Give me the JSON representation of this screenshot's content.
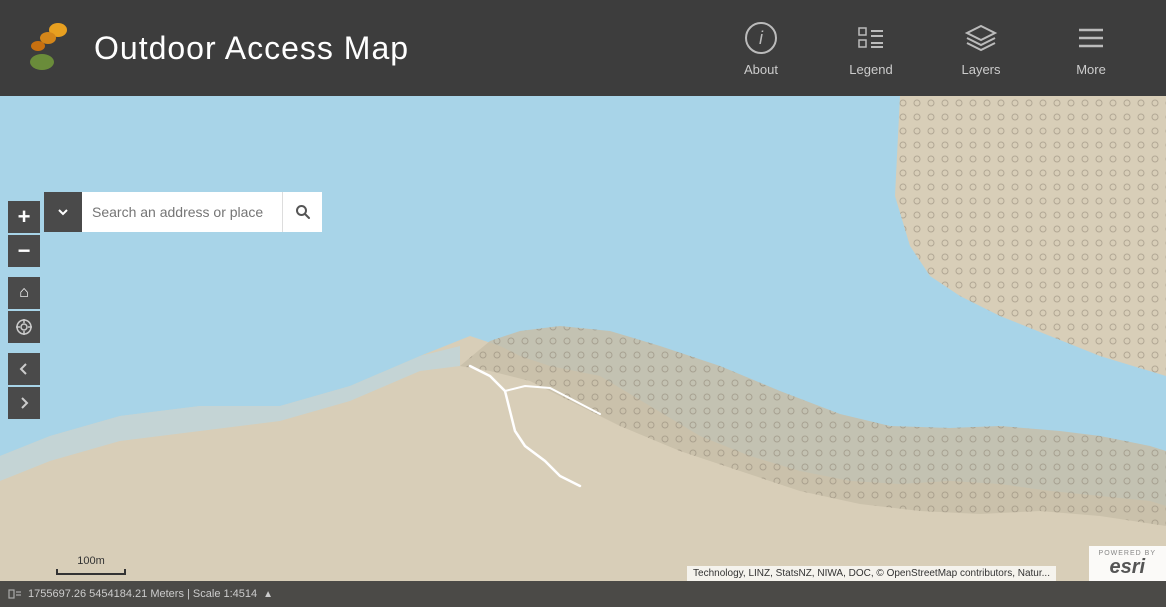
{
  "header": {
    "title": "Outdoor Access Map",
    "nav": [
      {
        "id": "about",
        "label": "About",
        "icon": "info-circle"
      },
      {
        "id": "legend",
        "label": "Legend",
        "icon": "legend"
      },
      {
        "id": "layers",
        "label": "Layers",
        "icon": "layers"
      },
      {
        "id": "more",
        "label": "More",
        "icon": "hamburger"
      }
    ]
  },
  "search": {
    "placeholder": "Search an address or place"
  },
  "controls": {
    "zoom_in": "+",
    "zoom_out": "−",
    "home": "⌂",
    "locate": "◎",
    "back": "←",
    "forward": "→"
  },
  "statusbar": {
    "coords": "1755697.26 5454184.21 Meters | Scale 1:4514",
    "expand_icon": "▲"
  },
  "scale": {
    "label": "100m"
  },
  "attribution": {
    "text": "Technology, LINZ, StatsNZ, NIWA, DOC, © OpenStreetMap contributors, Natur..."
  },
  "esri": {
    "powered_by": "POWERED BY",
    "brand": "esri"
  }
}
